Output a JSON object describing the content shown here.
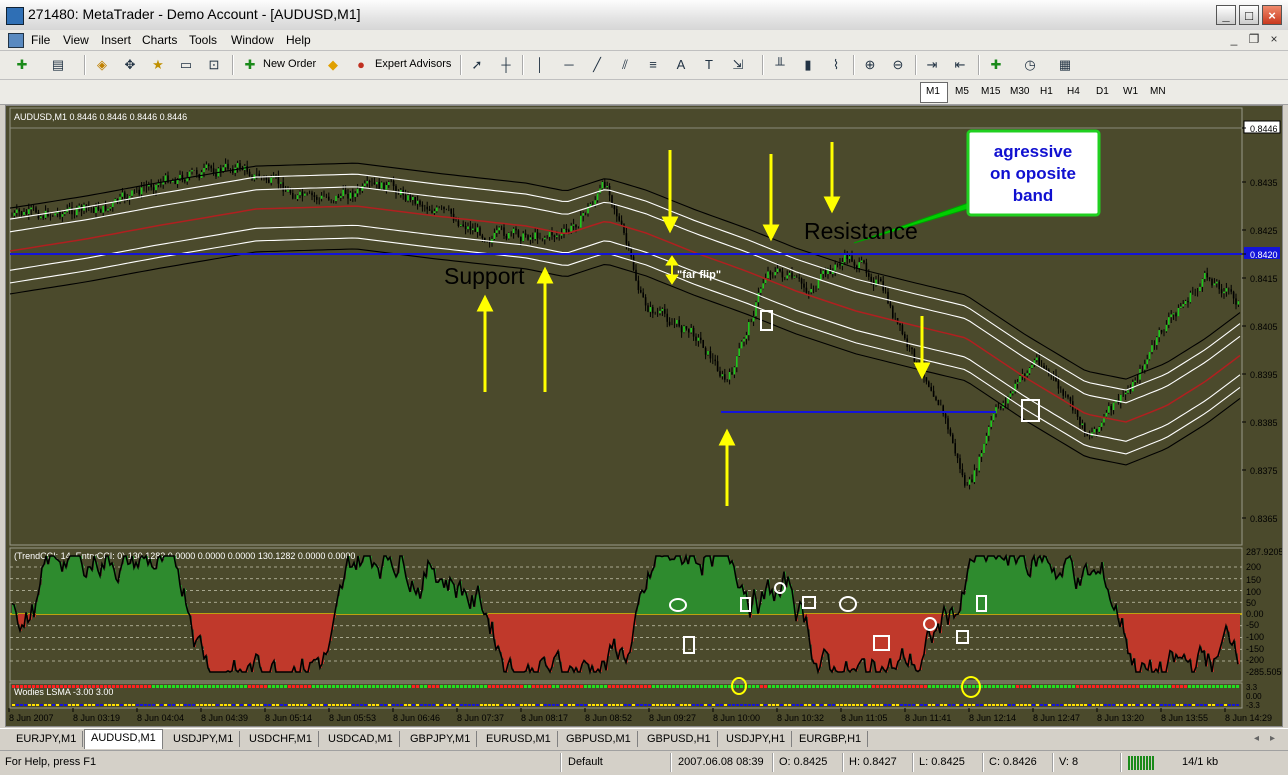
{
  "window": {
    "title": "271480: MetaTrader - Demo Account - [AUDUSD,M1]"
  },
  "menu": [
    "File",
    "View",
    "Insert",
    "Charts",
    "Tools",
    "Window",
    "Help"
  ],
  "toolbar": {
    "new_order": "New Order",
    "expert_advisors": "Expert Advisors"
  },
  "periods": [
    "M1",
    "M5",
    "M15",
    "M30",
    "H1",
    "H4",
    "D1",
    "W1",
    "MN"
  ],
  "chart": {
    "info": "AUDUSD,M1  0.8446 0.8446 0.8446 0.8446",
    "price_labels": [
      "0.8446",
      "0.8435",
      "0.8425",
      "0.8420",
      "0.8415",
      "0.8405",
      "0.8395",
      "0.8385",
      "0.8375",
      "0.8365"
    ],
    "annotations": {
      "callout_line1": "agressive",
      "callout_line2": "on oposite",
      "callout_line3": "band",
      "resistance": "Resistance",
      "support": "Support",
      "far_flip": "\"far flip\""
    },
    "cci": {
      "info": "(TrendCCI: 14, EntryCCI: 0)  130.1282 0.0000 0.0000 0.0000 130.1282 0.0000 0.0000",
      "labels": [
        "287.9205",
        "200",
        "150",
        "100",
        "50",
        "0.00",
        "-50",
        "-100",
        "-150",
        "-200",
        "-285.505"
      ]
    },
    "lsma": {
      "info": "Wodies LSMA -3.00 3.00",
      "labels": [
        "3.3",
        "0.00",
        "-3.3"
      ]
    },
    "time_labels": [
      "8 Jun 2007",
      "8 Jun 03:19",
      "8 Jun 04:04",
      "8 Jun 04:39",
      "8 Jun 05:14",
      "8 Jun 05:53",
      "8 Jun 06:46",
      "8 Jun 07:37",
      "8 Jun 08:17",
      "8 Jun 08:52",
      "8 Jun 09:27",
      "8 Jun 10:00",
      "8 Jun 10:32",
      "8 Jun 11:05",
      "8 Jun 11:41",
      "8 Jun 12:14",
      "8 Jun 12:47",
      "8 Jun 13:20",
      "8 Jun 13:55",
      "8 Jun 14:29"
    ]
  },
  "tabs": [
    "EURJPY,M1",
    "AUDUSD,M1",
    "USDJPY,M1",
    "USDCHF,M1",
    "USDCAD,M1",
    "GBPJPY,M1",
    "EURUSD,M1",
    "GBPUSD,M1",
    "GBPUSD,H1",
    "USDJPY,H1",
    "EURGBP,H1"
  ],
  "status": {
    "help": "For Help, press F1",
    "profile": "Default",
    "datetime": "2007.06.08 08:39",
    "open": "O: 0.8425",
    "high": "H: 0.8427",
    "low": "L: 0.8425",
    "close": "C: 0.8426",
    "volume": "V: 8",
    "traffic": "14/1 kb"
  },
  "colors": {
    "chart_bg": "#4b4a2c",
    "band_red": "#b02020",
    "support_line": "#1414d8",
    "arrow": "#ffff00",
    "callout_bg": "#00c000"
  }
}
